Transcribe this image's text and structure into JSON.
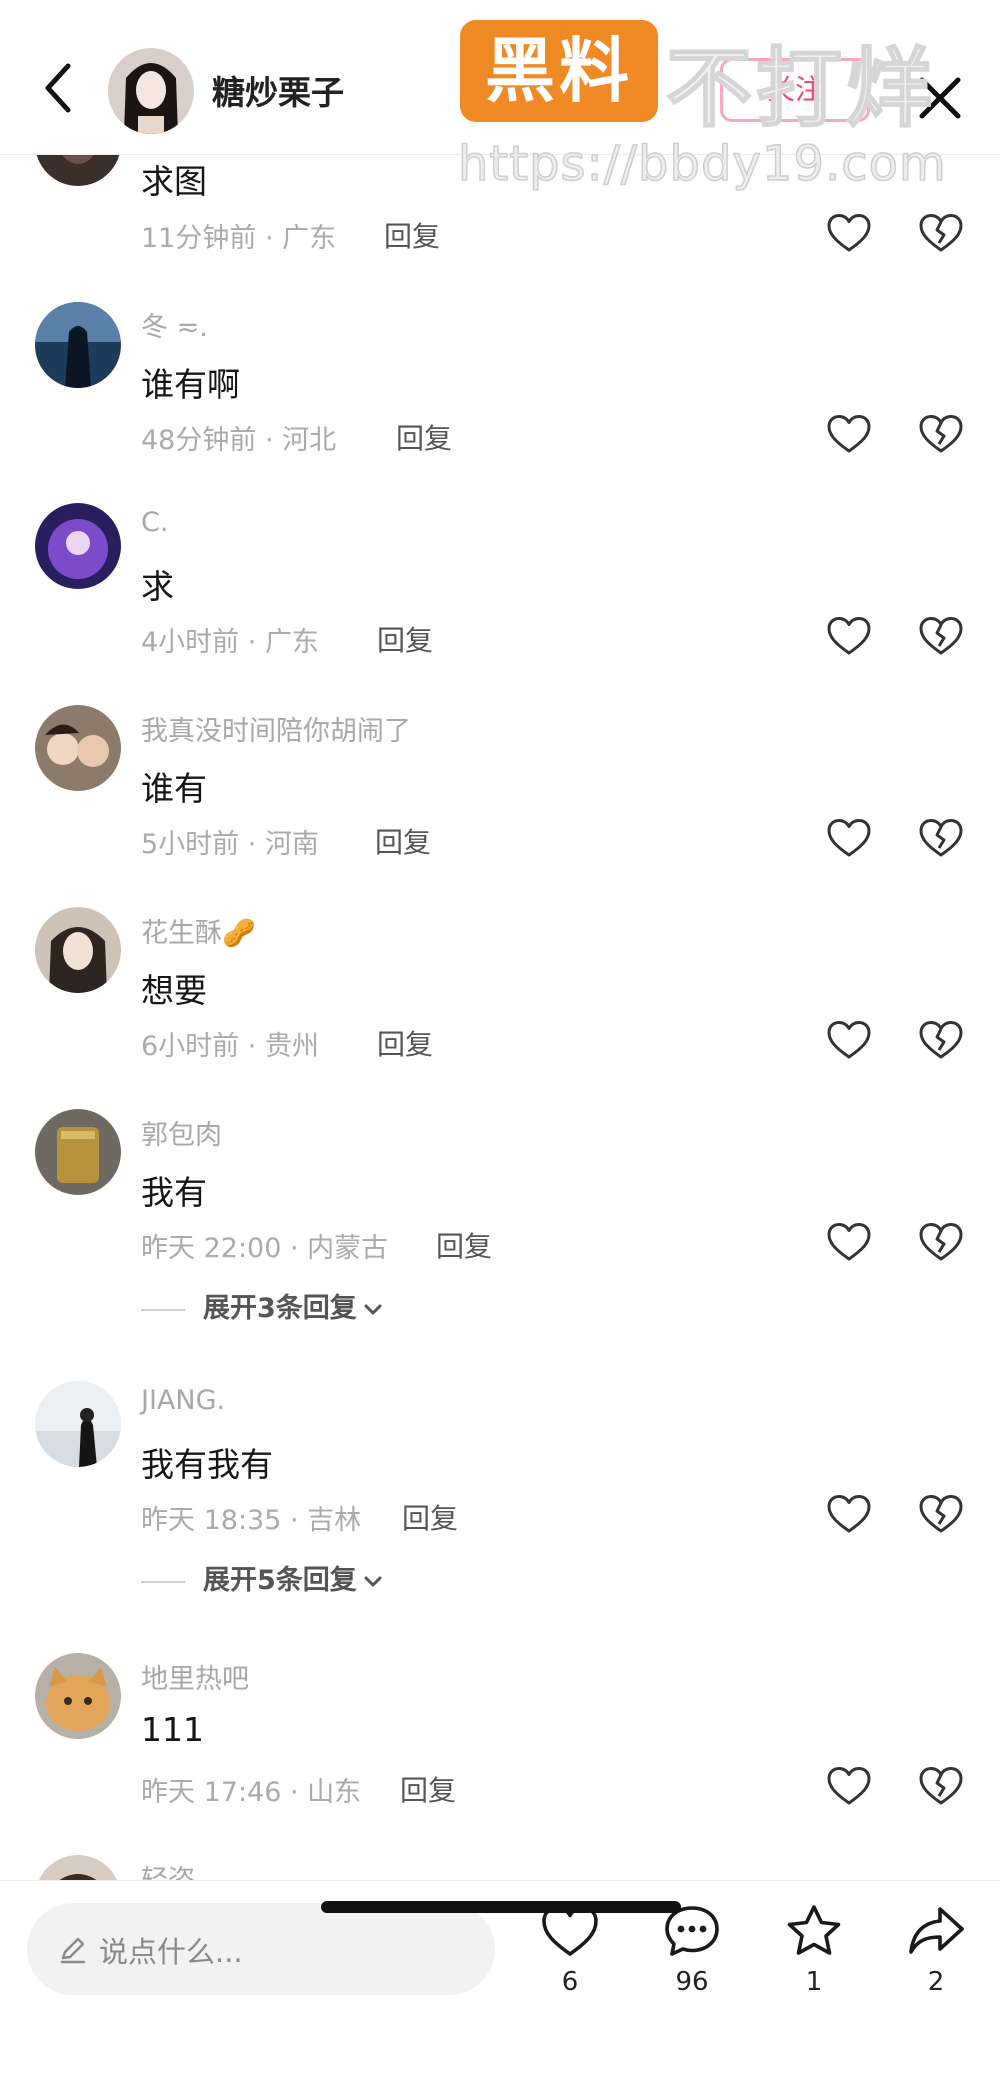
{
  "header": {
    "author_name": "糖炒栗子",
    "follow_label": "关注"
  },
  "watermark": {
    "badge": "黑料",
    "text": "不打烊",
    "url": "https://bbdy19.com"
  },
  "comments": [
    {
      "user": "",
      "text": "求图",
      "time": "11分钟前",
      "location": "广东",
      "reply_label": "回复"
    },
    {
      "user": "冬 ≂.",
      "text": "谁有啊",
      "time": "48分钟前",
      "location": "河北",
      "reply_label": "回复"
    },
    {
      "user": "C.",
      "text": "求",
      "time": "4小时前",
      "location": "广东",
      "reply_label": "回复"
    },
    {
      "user": "我真没时间陪你胡闹了",
      "text": "谁有",
      "time": "5小时前",
      "location": "河南",
      "reply_label": "回复"
    },
    {
      "user": "花生酥🥜",
      "text": "想要",
      "time": "6小时前",
      "location": "贵州",
      "reply_label": "回复"
    },
    {
      "user": "郭包肉",
      "text": "我有",
      "time": "昨天 22:00",
      "location": "内蒙古",
      "reply_label": "回复",
      "expand": "展开3条回复"
    },
    {
      "user": "JIANG.",
      "text": "我有我有",
      "time": "昨天 18:35",
      "location": "吉林",
      "reply_label": "回复",
      "expand": "展开5条回复"
    },
    {
      "user": "地里热吧",
      "text": "111",
      "time": "昨天 17:46",
      "location": "山东",
      "reply_label": "回复"
    },
    {
      "user": "轻盗"
    }
  ],
  "bottom": {
    "input_placeholder": "说点什么...",
    "likes": "6",
    "comments": "96",
    "favorites": "1",
    "shares": "2"
  },
  "icons": [
    "back-arrow-icon",
    "close-icon",
    "heart-icon",
    "broken-heart-icon",
    "pen-icon",
    "chat-bubble-icon",
    "star-icon",
    "share-arrow-icon",
    "chevron-down-icon"
  ],
  "colors": {
    "follow_accent": "#f24a6e",
    "watermark_badge": "#f08a24"
  }
}
